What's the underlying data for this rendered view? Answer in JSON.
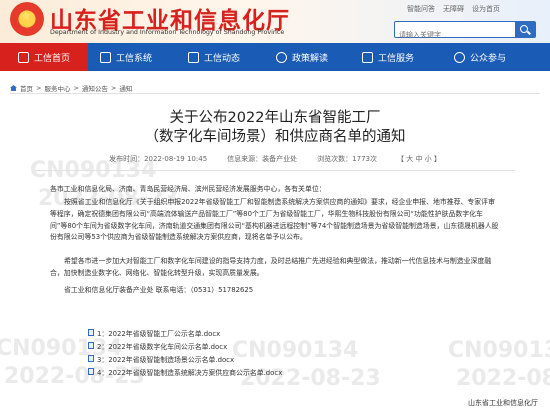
{
  "site": {
    "title": "山东省工业和信息化厅",
    "subtitle": "Department of Industry and Information Technology of Shandong Province"
  },
  "top_links": [
    "智能问答",
    "无障碍",
    "设为首页"
  ],
  "search": {
    "placeholder": "请输入关键字"
  },
  "nav": [
    {
      "label": "工信首页",
      "icon": "home-icon",
      "active": true
    },
    {
      "label": "工信系统",
      "icon": "system-icon"
    },
    {
      "label": "工信动态",
      "icon": "news-icon"
    },
    {
      "label": "政策解读",
      "icon": "policy-icon"
    },
    {
      "label": "工信服务",
      "icon": "service-icon"
    },
    {
      "label": "公众参与",
      "icon": "people-icon"
    }
  ],
  "breadcrumb": [
    "首页",
    "服务中心",
    "通知公告",
    "通知"
  ],
  "article": {
    "title_line1": "关于公布2022年山东省智能工厂",
    "title_line2": "（数字化车间场景）和供应商名单的通知",
    "published": "发布时间：2022-08-19 10:45",
    "source": "信息来源：装备产业处",
    "views": "浏览次数：1773次",
    "font_size": "【 大 中 小 】",
    "greeting": "各市工业和信息化局、济南、青岛民营经济局、滨州民营经济发展服务中心，各有关单位：",
    "paragraph1": "按照省工业和信息化厅《关于组织申报2022年省级智能工厂和智能制造系统解决方案供应商的通知》要求，经企业申报、地市推荐、专家评审等程序，确定祝德集团有限公司“高端流体输送产品智能工厂”等80个工厂为省级智能工厂，华熙生物科技股份有限公司“功能性护肤品数字化车间”等80个车间为省级数字化车间，济南轨道交通集团有限公司“基构机器进远程控制”等74个智能制造场景为省级智能制造场景，山东德晟机器人股份有限公司等53个供应商为省级智能制造系统解决方案供应商，现将名单予以公布。",
    "paragraph2": "希望各市进一步加大对智能工厂和数字化车间建设的指导支持力度，及时总结推广先进经验和典型做法，推动新一代信息技术与制造业深度融合，加快制造业数字化、网络化、智能化转型升级，实现高质量发展。",
    "contact": "省工业和信息化厅装备产业处    联系电话：（0531）51782625",
    "attachments": [
      "1：2022年省级智能工厂公示名单.docx",
      "2：2022年省级数字化车间公示名单.docx",
      "3：2022年省级智能制造场景公示名单.docx",
      "4：2022年省级智能制造系统解决方案供应商公示名单.docx"
    ],
    "signature": "山东省工业和信息化厅"
  },
  "watermark": [
    "CN090134",
    "2022-08-23"
  ],
  "colors": {
    "brand_red": "#d7211c",
    "nav_blue": "#1a5bb5"
  }
}
